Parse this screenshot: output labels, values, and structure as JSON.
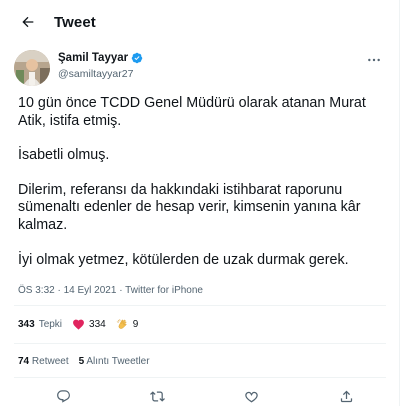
{
  "header": {
    "back_icon": "arrow-left-icon",
    "title": "Tweet"
  },
  "author": {
    "name": "Şamil Tayyar",
    "handle": "@samiltayyar27",
    "verified": true,
    "verified_color": "#1d9bf0"
  },
  "tweet": {
    "paragraphs": [
      "10 gün önce TCDD Genel Müdürü olarak atanan Murat Atik, istifa etmiş.",
      "İsabetli olmuş.",
      "Dilerim, referansı da hakkındaki istihbarat raporunu sümenaltı edenler de hesap verir, kimsenin yanına kâr kalmaz.",
      "İyi olmak yetmez, kötülerden de uzak durmak gerek."
    ]
  },
  "meta": {
    "time": "ÖS 3:32",
    "separator": "·",
    "date": "14 Eyl 2021",
    "source": "Twitter for iPhone"
  },
  "reactions": {
    "total_count": "343",
    "total_label": "Tepki",
    "items": [
      {
        "icon": "heart-icon",
        "count": "334",
        "color": "#e0245e"
      },
      {
        "icon": "clap-icon",
        "count": "9",
        "color": "#f4c04f"
      }
    ]
  },
  "counts": {
    "retweets_count": "74",
    "retweets_label": "Retweet",
    "quotes_count": "5",
    "quotes_label": "Alıntı Tweetler"
  },
  "actions": [
    {
      "icon": "reply-icon"
    },
    {
      "icon": "retweet-icon"
    },
    {
      "icon": "like-icon"
    },
    {
      "icon": "share-icon"
    }
  ]
}
